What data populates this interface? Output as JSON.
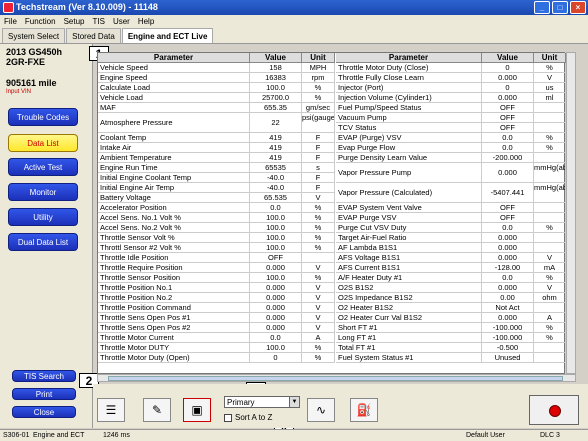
{
  "window": {
    "title": "Techstream (Ver 8.10.009) - 11148"
  },
  "menu": [
    "File",
    "Function",
    "Setup",
    "TIS",
    "User",
    "Help"
  ],
  "tabs": [
    "System Select",
    "Stored Data",
    "Engine and ECT Live"
  ],
  "vehicle": {
    "model": "2013 GS450h",
    "engine": "2GR-FXE",
    "mileage": "905161 mile",
    "vin_label": "Input VIN"
  },
  "sidebar": {
    "buttons": [
      "Trouble Codes",
      "Data List",
      "Active Test",
      "Monitor",
      "Utility",
      "Dual Data List"
    ],
    "bottom": [
      "TIS Search",
      "Print",
      "Close"
    ]
  },
  "callouts": [
    "1",
    "2",
    "3",
    "4"
  ],
  "grid": {
    "headers": [
      "Parameter",
      "Value",
      "Unit"
    ],
    "left": [
      [
        "Vehicle Speed",
        "158",
        "MPH"
      ],
      [
        "Engine Speed",
        "16383",
        "rpm"
      ],
      [
        "Calculate Load",
        "100.0",
        "%"
      ],
      [
        "Vehicle Load",
        "25700.0",
        "%"
      ],
      [
        "MAF",
        "655.35",
        "gm/sec"
      ],
      [
        "Atmosphere Pressure",
        "22",
        "psi(gauge)"
      ],
      [
        "Coolant Temp",
        "419",
        "F"
      ],
      [
        "Intake Air",
        "419",
        "F"
      ],
      [
        "Ambient Temperature",
        "419",
        "F"
      ],
      [
        "Engine Run Time",
        "65535",
        "s"
      ],
      [
        "Initial Engine Coolant Temp",
        "-40.0",
        "F"
      ],
      [
        "Initial Engine Air Temp",
        "-40.0",
        "F"
      ],
      [
        "Battery Voltage",
        "65.535",
        "V"
      ],
      [
        "Accelerator Position",
        "0.0",
        "%"
      ],
      [
        "Accel Sens. No.1 Volt %",
        "100.0",
        "%"
      ],
      [
        "Accel Sens. No.2 Volt %",
        "100.0",
        "%"
      ],
      [
        "Throttle Sensor Volt %",
        "100.0",
        "%"
      ],
      [
        "Throttl Sensor #2 Volt %",
        "100.0",
        "%"
      ],
      [
        "Throttle Idle Position",
        "OFF",
        ""
      ],
      [
        "Throttle Require Position",
        "0.000",
        "V"
      ],
      [
        "Throttle Sensor Position",
        "100.0",
        "%"
      ],
      [
        "Throttle Position No.1",
        "0.000",
        "V"
      ],
      [
        "Throttle Position No.2",
        "0.000",
        "V"
      ],
      [
        "Throttle Position Command",
        "0.000",
        "V"
      ],
      [
        "Throttle Sens Open Pos #1",
        "0.000",
        "V"
      ],
      [
        "Throttle Sens Open Pos #2",
        "0.000",
        "V"
      ],
      [
        "Throttle Motor Current",
        "0.0",
        "A"
      ],
      [
        "Throttle Motor DUTY",
        "100.0",
        "%"
      ],
      [
        "Throttle Motor Duty (Open)",
        "0",
        "%"
      ]
    ],
    "right": [
      [
        "Throttle Motor Duty (Close)",
        "0",
        "%"
      ],
      [
        "Throttle Fully Close Learn",
        "0.000",
        "V"
      ],
      [
        "Injector (Port)",
        "0",
        "us"
      ],
      [
        "Injection Volume (Cylinder1)",
        "0.000",
        "ml"
      ],
      [
        "Fuel Pump/Speed Status",
        "OFF",
        ""
      ],
      [
        "Vacuum Pump",
        "OFF",
        ""
      ],
      [
        "TCV Status",
        "OFF",
        ""
      ],
      [
        "EVAP (Purge) VSV",
        "0.0",
        "%"
      ],
      [
        "Evap Purge Flow",
        "0.0",
        "%"
      ],
      [
        "Purge Density Learn Value",
        "-200.000",
        ""
      ],
      [
        "Vapor Pressure Pump",
        "0.000",
        "mmHg(abs)"
      ],
      [
        "Vapor Pressure (Calculated)",
        "-5407.441",
        "mmHg(abs)"
      ],
      [
        "EVAP System Vent Valve",
        "OFF",
        ""
      ],
      [
        "EVAP Purge VSV",
        "OFF",
        ""
      ],
      [
        "Purge Cut VSV Duty",
        "0.0",
        "%"
      ],
      [
        "Target Air-Fuel Ratio",
        "0.000",
        ""
      ],
      [
        "AF Lambda B1S1",
        "0.000",
        ""
      ],
      [
        "AFS Voltage B1S1",
        "0.000",
        "V"
      ],
      [
        "AFS Current B1S1",
        "-128.00",
        "mA"
      ],
      [
        "A/F Heater Duty #1",
        "0.0",
        "%"
      ],
      [
        "O2S B1S2",
        "0.000",
        "V"
      ],
      [
        "O2S Impedance B1S2",
        "0.00",
        "ohm"
      ],
      [
        "O2 Heater B1S2",
        "Not Act",
        ""
      ],
      [
        "O2 Heater Curr Val B1S2",
        "0.000",
        "A"
      ],
      [
        "Short FT #1",
        "-100.000",
        "%"
      ],
      [
        "Long FT #1",
        "-100.000",
        "%"
      ],
      [
        "Total FT #1",
        "-0.500",
        ""
      ],
      [
        "Fuel System Status #1",
        "Unused",
        ""
      ]
    ]
  },
  "toolbar": {
    "select_value": "Primary",
    "sort_label": "Sort A to Z"
  },
  "status": {
    "code": "S306-01",
    "system": "Engine and ECT",
    "time": "1246 ms",
    "user": "Default User",
    "dlc": "DLC 3"
  }
}
